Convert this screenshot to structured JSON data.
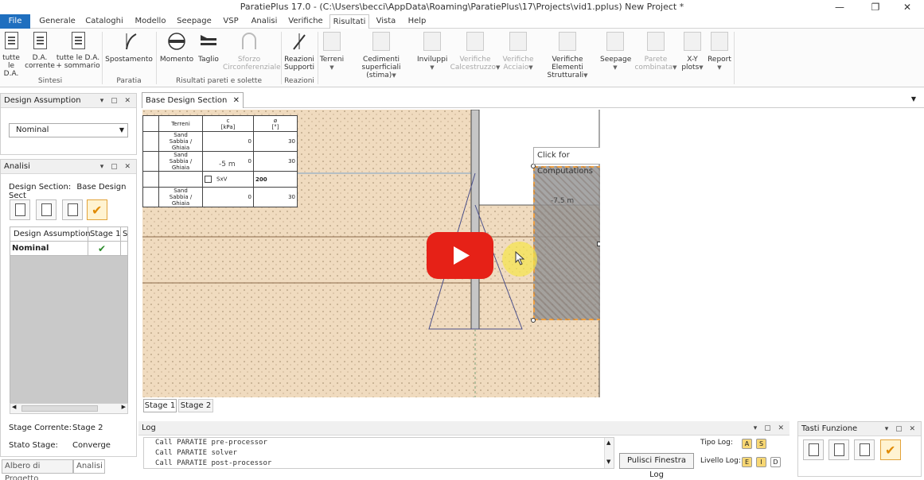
{
  "window": {
    "title": "ParatiePlus 17.0 - (C:\\Users\\becci\\AppData\\Roaming\\ParatiePlus\\17\\Projects\\vid1.pplus) New Project *"
  },
  "menu": [
    "File",
    "Generale",
    "Cataloghi",
    "Modello",
    "Seepage",
    "VSP",
    "Analisi",
    "Verifiche",
    "Risultati",
    "Vista",
    "Help"
  ],
  "ribbon": {
    "b1": [
      "tutte",
      "le D.A."
    ],
    "b2": [
      "D.A.",
      "corrente"
    ],
    "b3": [
      "tutte le D.A.",
      "+ sommario"
    ],
    "b4": "Spostamento",
    "b5": "Momento",
    "b6": "Taglio",
    "b7": [
      "Sforzo",
      "Circonferenziale"
    ],
    "b8": [
      "Reazioni",
      "Supporti"
    ],
    "b9": "Terreni",
    "b10": [
      "Cedimenti",
      "superficiali (stima)"
    ],
    "b11": "Inviluppi",
    "b12": [
      "Verifiche",
      "Calcestruzzo"
    ],
    "b13": [
      "Verifiche",
      "Acciaio"
    ],
    "b14": [
      "Verifiche Elementi",
      "Strutturali"
    ],
    "b15": "Seepage",
    "b16": [
      "Parete",
      "combinata"
    ],
    "b17": [
      "X-Y",
      "plots"
    ],
    "b18": "Report",
    "groups": {
      "sintesi": "Sintesi",
      "paratia": "Paratia",
      "pareti": "Risultati pareti e solette",
      "reazioni": "Reazioni"
    }
  },
  "left": {
    "design_assumption_title": "Design Assumption",
    "design_assumption_value": "Nominal",
    "analisi_title": "Analisi",
    "design_section_label": "Design Section:",
    "design_section_value": "Base Design Sect",
    "grid_headers": [
      "Design Assumption",
      "Stage 1",
      "S"
    ],
    "grid_row": "Nominal",
    "stage_corrente_label": "Stage Corrente:",
    "stage_corrente_value": "Stage 2",
    "stato_stage_label": "Stato Stage:",
    "stato_stage_value": "Converge",
    "bottom_tabs": [
      "Albero di Progetto",
      "Analisi"
    ]
  },
  "doc": {
    "tab": "Base Design Section",
    "tooltip": "Click for Computations",
    "depth_label": "-7.5 m",
    "depth_label2": "-5 m",
    "stage_tabs": [
      "Stage 1",
      "Stage 2"
    ],
    "soil_table": {
      "headers": [
        "Terreni",
        "c",
        "[kPa]",
        "ø",
        "[°]"
      ],
      "rows": [
        {
          "name": [
            "Sand",
            "Sabbia / Ghiaia"
          ],
          "c": "0",
          "phi": "30"
        },
        {
          "name": [
            "Sand",
            "Sabbia / Ghiaia"
          ],
          "c": "0",
          "phi": "30"
        },
        {
          "name": [],
          "c": "SxV",
          "phi": "200"
        },
        {
          "name": [
            "Sand",
            "Sabbia / Ghiaia"
          ],
          "c": "0",
          "phi": "30"
        }
      ]
    }
  },
  "log": {
    "title": "Log",
    "lines": [
      "Call PARATIE pre-processor",
      "Call PARATIE solver",
      "Call PARATIE post-processor"
    ],
    "clear_button": "Pulisci Finestra Log",
    "tipo_log": "Tipo Log:",
    "livello_log": "Livello Log:",
    "tipo_buttons": [
      "A",
      "S"
    ],
    "livello_buttons": [
      "E",
      "I",
      "D"
    ]
  },
  "tasti": {
    "title": "Tasti Funzione"
  },
  "colors": {
    "accent": "#1f6fbf",
    "soil": "#f0dbbf",
    "youtube": "#e62117",
    "cursor_highlight": "#f5e64a"
  }
}
